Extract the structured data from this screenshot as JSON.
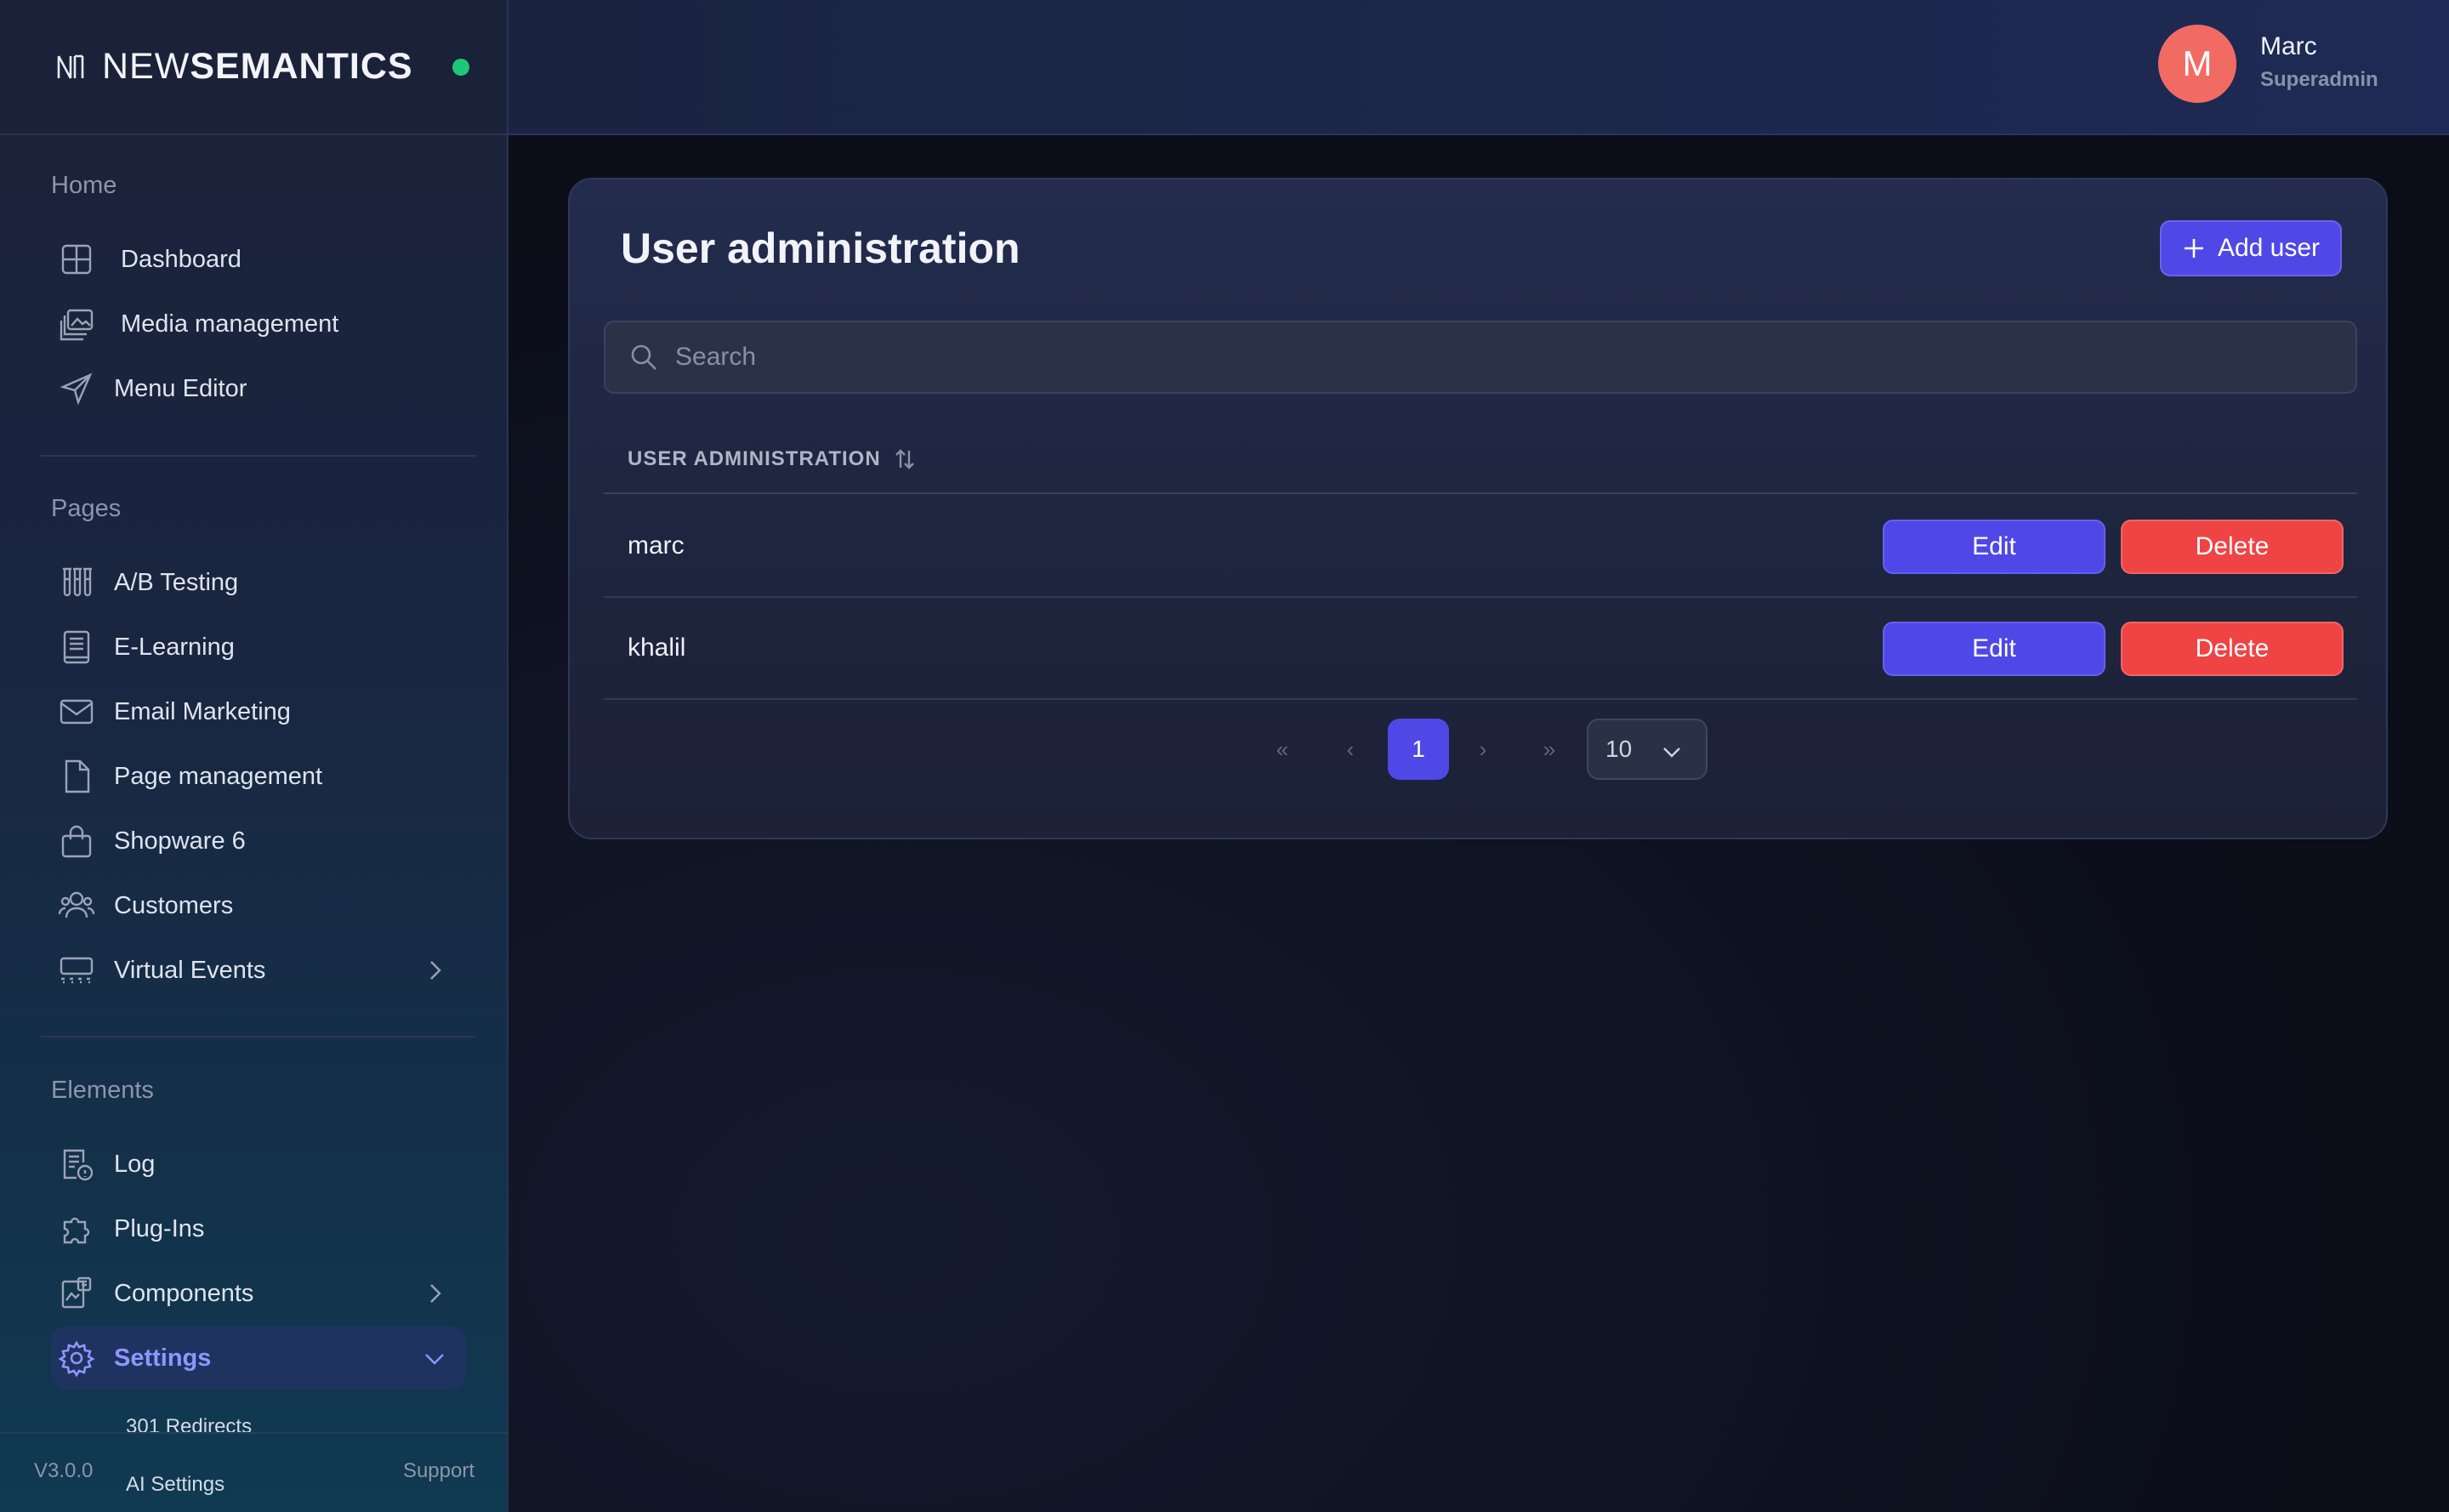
{
  "brand": {
    "prefix": "NEW",
    "name": "SEMANTICS"
  },
  "sidebar": {
    "sections": [
      {
        "title": "Home",
        "items": [
          {
            "label": "Dashboard",
            "icon": "dashboard-icon"
          },
          {
            "label": "Media management",
            "icon": "media-icon"
          },
          {
            "label": "Menu Editor",
            "icon": "send-icon"
          }
        ]
      },
      {
        "title": "Pages",
        "items": [
          {
            "label": "A/B Testing",
            "icon": "test-tubes-icon"
          },
          {
            "label": "E-Learning",
            "icon": "book-icon"
          },
          {
            "label": "Email Marketing",
            "icon": "mail-icon"
          },
          {
            "label": "Page management",
            "icon": "file-icon"
          },
          {
            "label": "Shopware 6",
            "icon": "shopping-bag-icon"
          },
          {
            "label": "Customers",
            "icon": "users-icon"
          },
          {
            "label": "Virtual Events",
            "icon": "events-icon"
          }
        ]
      },
      {
        "title": "Elements",
        "items": [
          {
            "label": "Log",
            "icon": "log-icon"
          },
          {
            "label": "Plug-Ins",
            "icon": "puzzle-icon"
          },
          {
            "label": "Components",
            "icon": "components-icon"
          },
          {
            "label": "Settings",
            "icon": "gear-icon"
          }
        ]
      }
    ],
    "settings_sub": [
      "301 Redirects",
      "AI Settings"
    ],
    "version": "V3.0.0",
    "support": "Support"
  },
  "header": {
    "avatar_initial": "M",
    "user_name": "Marc",
    "user_role": "Superadmin"
  },
  "main": {
    "title": "User administration",
    "add_user_label": "Add user",
    "search_placeholder": "Search",
    "column_header": "USER ADMINISTRATION",
    "rows": [
      {
        "name": "marc",
        "edit": "Edit",
        "delete": "Delete"
      },
      {
        "name": "khalil",
        "edit": "Edit",
        "delete": "Delete"
      }
    ],
    "pagination": {
      "first": "«",
      "prev": "‹",
      "current": "1",
      "next": "›",
      "last": "»",
      "rows_per_page": "10"
    }
  },
  "colors": {
    "accent": "#4f48e6",
    "danger": "#ef4444",
    "avatar": "#f26b63",
    "status": "#1fc77a"
  }
}
